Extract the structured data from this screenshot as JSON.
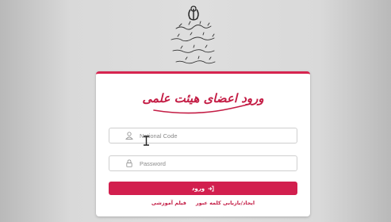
{
  "login": {
    "title": "ورود اعضای هیئت علمی",
    "national_code_placeholder": "National Code",
    "password_placeholder": "Password",
    "login_button": "ورود",
    "links": [
      {
        "label": "ایجاد/بازیابی کلمه عبور"
      },
      {
        "label": "فیلم آموزشی"
      }
    ]
  },
  "icons": {
    "emblem": "iran-emblem-icon",
    "user": "user-icon",
    "lock": "lock-icon",
    "login": "sign-in-icon",
    "cursor": "text-cursor-icon"
  },
  "colors": {
    "accent": "#d21f4e",
    "title": "#c41d45",
    "background": "#dedede"
  }
}
